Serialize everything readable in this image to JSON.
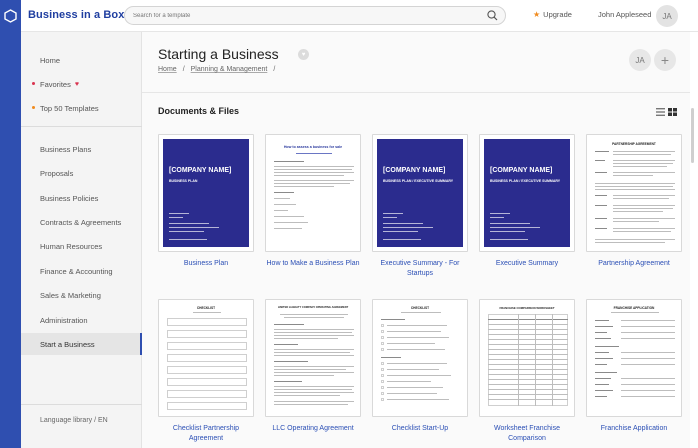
{
  "app": {
    "brand": "Business in a Box",
    "search_placeholder": "Search for a template",
    "upgrade_label": "Upgrade",
    "user_name": "John Appleseed",
    "user_initials": "JA",
    "accent_color": "#2f4fb0",
    "upgrade_star_color": "#f08b1e"
  },
  "sidebar": {
    "items": [
      {
        "label": "Home"
      },
      {
        "label": "Favorites"
      },
      {
        "label": "Top 50 Templates"
      },
      {
        "label": "Business Plans"
      },
      {
        "label": "Proposals"
      },
      {
        "label": "Business Policies"
      },
      {
        "label": "Contracts & Agreements"
      },
      {
        "label": "Human Resources"
      },
      {
        "label": "Finance & Accounting"
      },
      {
        "label": "Sales & Marketing"
      },
      {
        "label": "Administration"
      },
      {
        "label": "Start a Business"
      }
    ],
    "active_index": 11,
    "favorites_dot_color": "#d9334f",
    "top50_dot_color": "#f08b1e",
    "language_label": "Language library / EN"
  },
  "main": {
    "title": "Starting a Business",
    "avatar_initials": "JA",
    "breadcrumb": [
      "Home",
      "/",
      "Planning & Management",
      "/"
    ],
    "section_title": "Documents & Files",
    "documents": [
      {
        "label": "Business Plan",
        "cover": {
          "company": "[COMPANY NAME]",
          "subtitle": "BUSINESS PLAN"
        }
      },
      {
        "label": "How to Make a Business Plan",
        "doc_title": "How to assess a business for sale"
      },
      {
        "label": "Executive Summary - For Startups",
        "cover": {
          "company": "[COMPANY NAME]",
          "subtitle": "BUSINESS PLAN / EXECUTIVE SUMMARY"
        }
      },
      {
        "label": "Executive Summary",
        "cover": {
          "company": "[COMPANY NAME]",
          "subtitle": "BUSINESS PLAN / EXECUTIVE SUMMARY"
        }
      },
      {
        "label": "Partnership Agreement",
        "doc_title": "PARTNERSHIP AGREEMENT"
      },
      {
        "label": "Checklist Partnership Agreement",
        "doc_title": "CHECKLIST"
      },
      {
        "label": "LLC Operating Agreement",
        "doc_title": "LIMITED LIABILITY COMPANY OPERATING AGREEMENT"
      },
      {
        "label": "Checklist Start-Up",
        "doc_title": "CHECKLIST"
      },
      {
        "label": "Worksheet Franchise Comparison",
        "doc_title": "FRANCHISE COMPARISON WORKSHEET"
      },
      {
        "label": "Franchise Application",
        "doc_title": "FRANCHISE APPLICATION"
      }
    ]
  }
}
